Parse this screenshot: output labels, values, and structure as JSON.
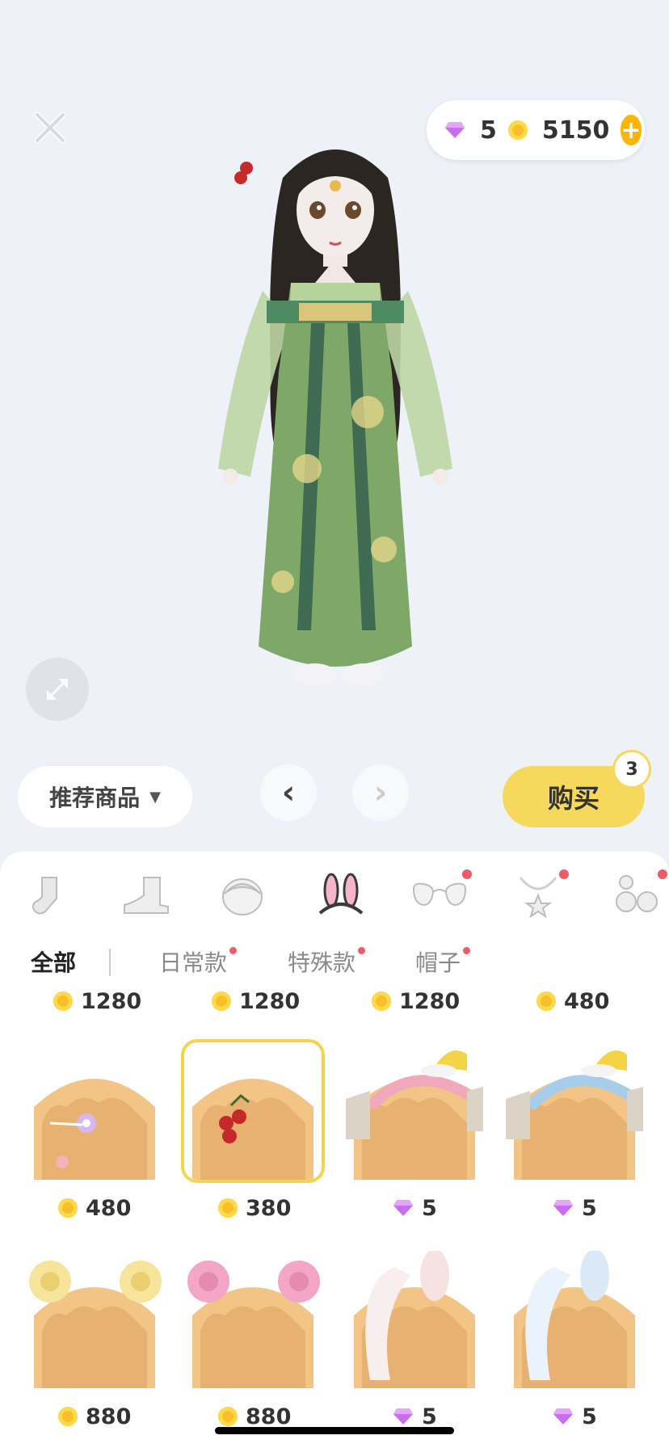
{
  "currency": {
    "gems": "5",
    "coins": "5150"
  },
  "shop": {
    "recommend_label": "推荐商品",
    "buy_label": "购买",
    "buy_count": "3"
  },
  "categories": [
    {
      "icon": "sock-icon"
    },
    {
      "icon": "shoe-icon"
    },
    {
      "icon": "hair-icon"
    },
    {
      "icon": "bunny-ears-icon",
      "active": true
    },
    {
      "icon": "glasses-icon",
      "dot": true
    },
    {
      "icon": "necklace-icon",
      "dot": true
    },
    {
      "icon": "earrings-icon",
      "dot": true
    }
  ],
  "subtabs": [
    {
      "label": "全部",
      "active": true
    },
    {
      "label": "日常款",
      "dot": true
    },
    {
      "label": "特殊款",
      "dot": true
    },
    {
      "label": "帽子",
      "dot": true
    }
  ],
  "top_prices": [
    "1280",
    "1280",
    "1280",
    "480"
  ],
  "items": [
    {
      "name": "flower-hairclip-item",
      "price": "480",
      "currency": "coin"
    },
    {
      "name": "cherry-hairclip-item",
      "price": "380",
      "currency": "coin",
      "selected": true
    },
    {
      "name": "pink-santa-hat-headband-item",
      "price": "5",
      "currency": "gem"
    },
    {
      "name": "blue-santa-hat-headband-item",
      "price": "5",
      "currency": "gem"
    },
    {
      "name": "yellow-ram-horns-item",
      "price": "880",
      "currency": "coin"
    },
    {
      "name": "pink-ram-horns-item",
      "price": "880",
      "currency": "coin"
    },
    {
      "name": "pink-bunny-ears-item",
      "price": "5",
      "currency": "gem"
    },
    {
      "name": "blue-bunny-ears-item",
      "price": "5",
      "currency": "gem"
    }
  ]
}
